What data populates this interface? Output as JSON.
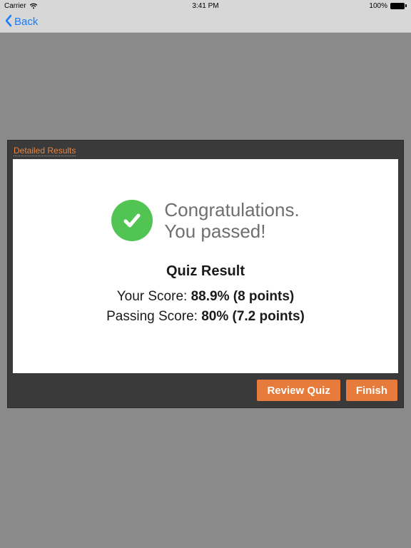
{
  "statusbar": {
    "carrier": "Carrier",
    "time": "3:41 PM",
    "battery_pct": "100%"
  },
  "nav": {
    "back_label": "Back"
  },
  "panel": {
    "detailed_results_label": "Detailed Results",
    "congrats_line1": "Congratulations.",
    "congrats_line2": "You passed!",
    "result_title": "Quiz Result",
    "your_score_label": "Your Score: ",
    "your_score_value": "88.9% (8 points)",
    "passing_score_label": "Passing Score: ",
    "passing_score_value": "80% (7.2 points)",
    "review_button": "Review Quiz",
    "finish_button": "Finish"
  }
}
